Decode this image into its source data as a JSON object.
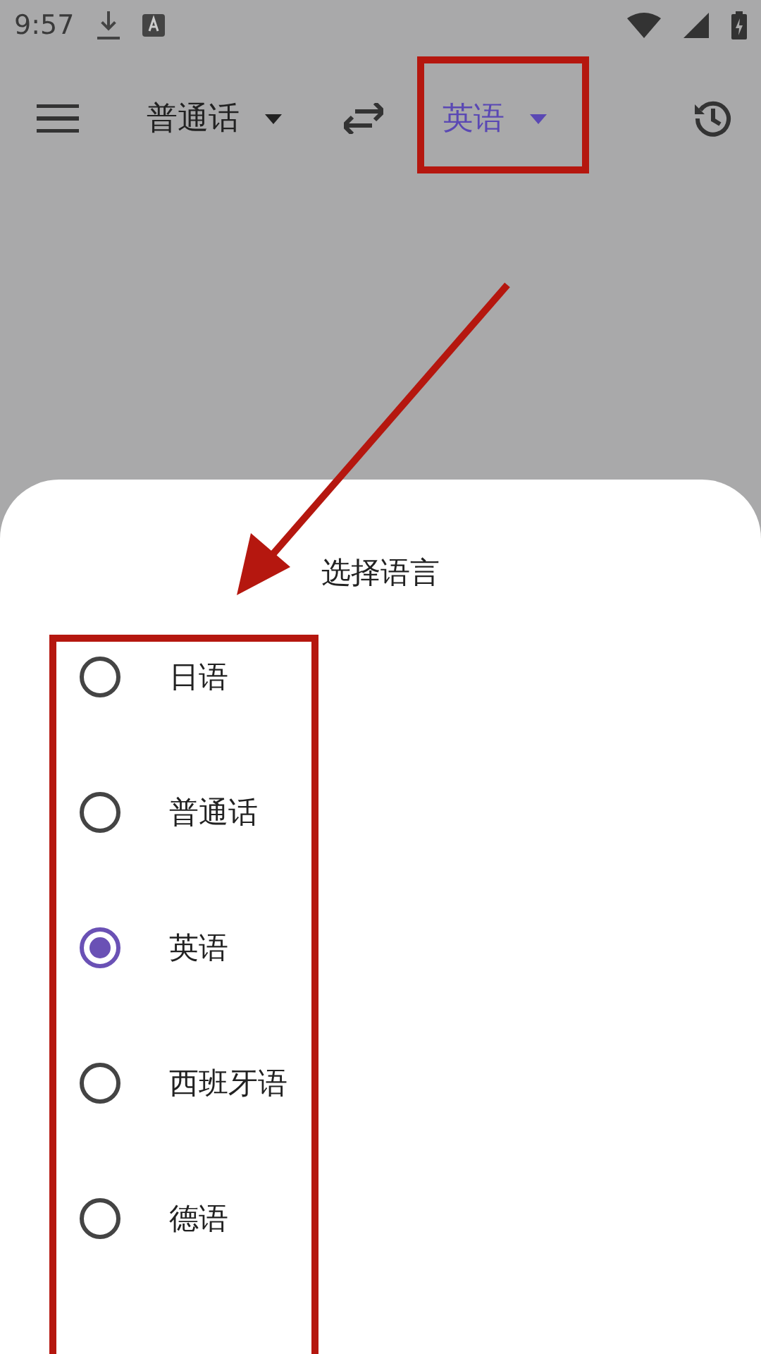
{
  "status_bar": {
    "time": "9:57"
  },
  "toolbar": {
    "source_language": "普通话",
    "target_language": "英语"
  },
  "sheet": {
    "title": "选择语言",
    "options": [
      {
        "label": "日语",
        "selected": false
      },
      {
        "label": "普通话",
        "selected": false
      },
      {
        "label": "英语",
        "selected": true
      },
      {
        "label": "西班牙语",
        "selected": false
      },
      {
        "label": "德语",
        "selected": false
      }
    ]
  }
}
